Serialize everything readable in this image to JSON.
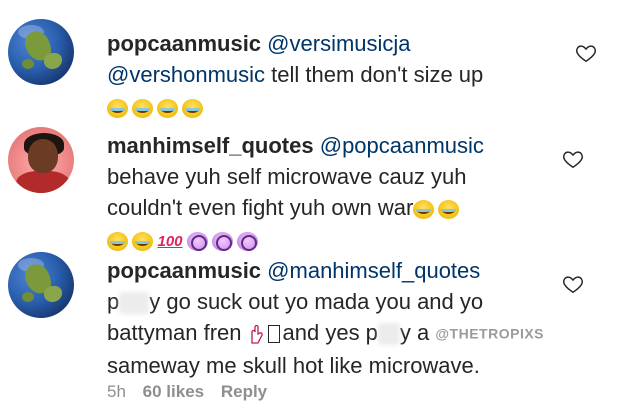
{
  "comments": [
    {
      "username": "popcaanmusic",
      "mention": "@versimusicja",
      "line2_mention": "@vershonmusic",
      "line2_text": " tell them don't size up",
      "emojis": [
        "tears-of-joy",
        "tears-of-joy",
        "tears-of-joy",
        "tears-of-joy"
      ]
    },
    {
      "username": "manhimself_quotes",
      "mention": "@popcaanmusic",
      "line2": "behave yuh self microwave cauz yuh",
      "line3": "couldn't even fight yuh own war",
      "line3_emojis": [
        "tears-of-joy",
        "tears-of-joy"
      ],
      "emojis": [
        "tears-of-joy",
        "tears-of-joy",
        "hundred",
        "dizzy-face",
        "dizzy-face",
        "dizzy-face"
      ],
      "hundred_text": "100"
    },
    {
      "username": "popcaanmusic",
      "mention": "@manhimself_quotes",
      "line2_a": "p",
      "line2_b": "y go suck out yo mada you and yo",
      "line3_a": "battyman fren",
      "line3_b": "and yes p",
      "line3_c": "y a",
      "watermark": "@THETROPIXS",
      "line4": "sameway me skull hot like microwave.",
      "time": "5h",
      "likes": "60 likes",
      "reply": "Reply"
    }
  ],
  "icons": {
    "heart": "heart-outline-icon"
  },
  "colors": {
    "text": "#262626",
    "mention": "#003569",
    "meta": "#8e8e8e"
  }
}
